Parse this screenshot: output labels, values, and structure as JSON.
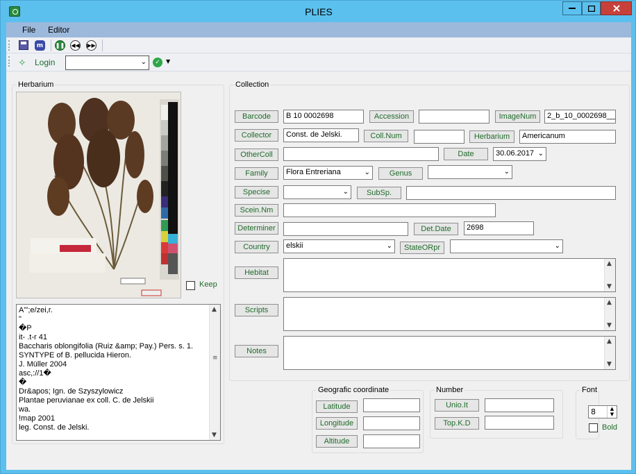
{
  "window": {
    "title": "PLIES"
  },
  "menu": {
    "file": "File",
    "editor": "Editor"
  },
  "toolbar": {
    "icons": [
      "save-icon",
      "database-icon",
      "pause-icon",
      "rewind-icon",
      "fast-forward-icon"
    ],
    "login_label": "Login",
    "login_value": ""
  },
  "herbarium": {
    "legend": "Herbarium",
    "keep_label": "Keep",
    "keep_checked": false,
    "ocr_text": "A\"';e/zei,r.\n\"\n�P\nit- .t-r 41\nBaccharis oblongifolia (Ruiz &amp; Pay.) Pers. s. 1.\nSYNTYPE of B. pellucida Hieron.\nJ. Müller 2004\nasc,://1�\n�\nDr&apos; Ign. de Szyszylowicz\nPlantae peruvianae ex coll. C. de Jelskii\nwa.\n!map 2001\nleg. Const. de Jelski."
  },
  "collection": {
    "legend": "Collection",
    "barcode": {
      "label": "Barcode",
      "value": "B 10 0002698"
    },
    "accession": {
      "label": "Accession",
      "value": ""
    },
    "imagenum": {
      "label": "ImageNum",
      "value": "2_b_10_0002698__"
    },
    "collector": {
      "label": "Collector",
      "value": "Const. de Jelski."
    },
    "collnum": {
      "label": "Coll.Num",
      "value": ""
    },
    "herbarium": {
      "label": "Herbarium",
      "value": "Americanum"
    },
    "othercoll": {
      "label": "OtherColl",
      "value": ""
    },
    "date": {
      "label": "Date",
      "value": "30.06.2017"
    },
    "family": {
      "label": "Family",
      "value": "Flora Entreriana"
    },
    "genus": {
      "label": "Genus",
      "value": ""
    },
    "specise": {
      "label": "Specise",
      "value": ""
    },
    "subsp": {
      "label": "SubSp.",
      "value": ""
    },
    "sceinnm": {
      "label": "Scein.Nm",
      "value": ""
    },
    "determiner": {
      "label": "Determiner",
      "value": ""
    },
    "detdate": {
      "label": "Det.Date",
      "value": "2698"
    },
    "country": {
      "label": "Country",
      "value": "elskii"
    },
    "stateorpr": {
      "label": "StateORpr",
      "value": ""
    },
    "hebitat": {
      "label": "Hebitat",
      "value": ""
    },
    "scripts": {
      "label": "Scripts",
      "value": ""
    },
    "notes": {
      "label": "Notes",
      "value": ""
    }
  },
  "geo": {
    "legend": "Geografic coordinate",
    "latitude": {
      "label": "Latitude",
      "value": ""
    },
    "longitude": {
      "label": "Longitude",
      "value": ""
    },
    "altitude": {
      "label": "Altitude",
      "value": ""
    }
  },
  "number": {
    "legend": "Number",
    "unioit": {
      "label": "Unio.It",
      "value": ""
    },
    "topkd": {
      "label": "Top.K.D",
      "value": ""
    }
  },
  "font": {
    "legend": "Font",
    "size": "8",
    "bold_label": "Bold",
    "bold_checked": false
  }
}
